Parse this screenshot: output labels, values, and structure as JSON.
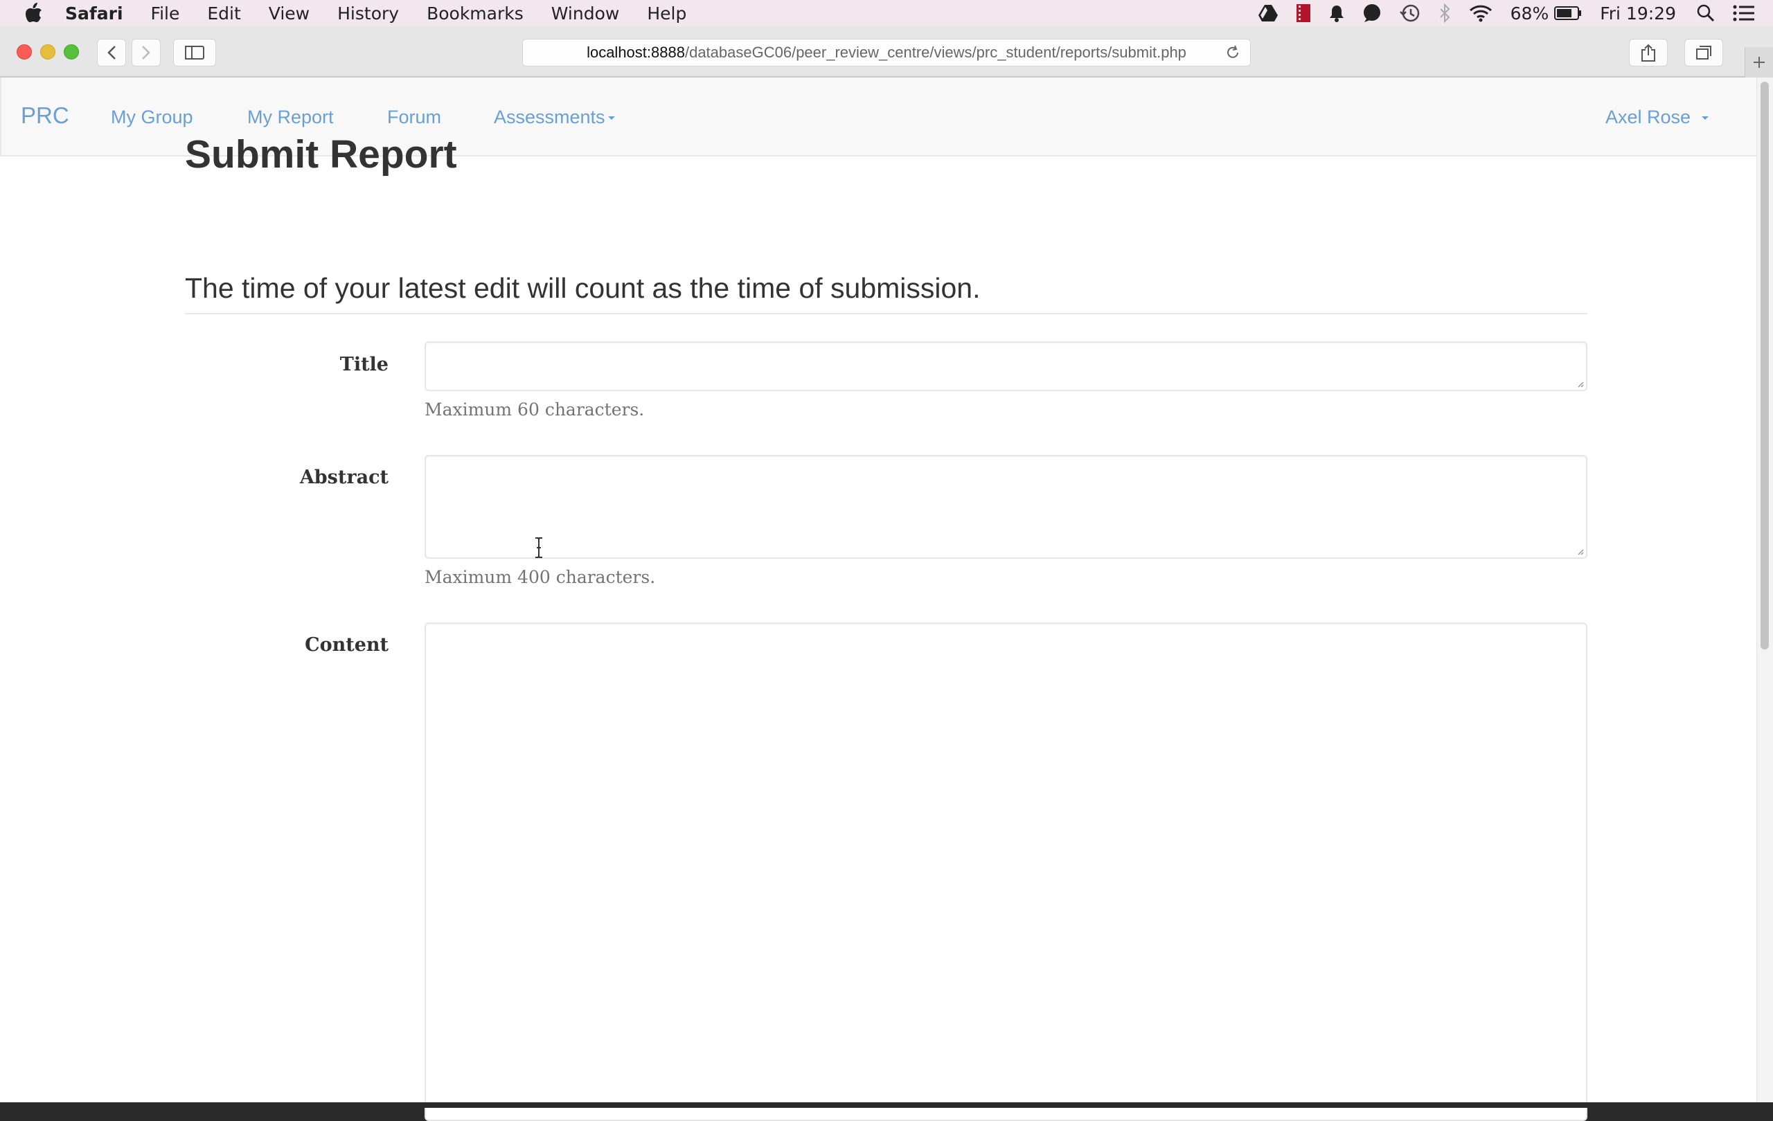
{
  "menubar": {
    "app_name": "Safari",
    "items": [
      "File",
      "Edit",
      "View",
      "History",
      "Bookmarks",
      "Window",
      "Help"
    ],
    "status_icons": [
      "google-drive-icon",
      "stopwatch-icon",
      "notification-bell-icon",
      "speech-bubble-icon",
      "time-machine-icon",
      "bluetooth-icon",
      "wifi-icon"
    ],
    "battery_percent": "68%",
    "clock": "Fri 19:29"
  },
  "browser": {
    "url_host": "localhost:8888",
    "url_path": "/databaseGC06/peer_review_centre/views/prc_student/reports/submit.php"
  },
  "navbar": {
    "brand": "PRC",
    "links": [
      "My Group",
      "My Report",
      "Forum",
      "Assessments"
    ],
    "user": "Axel Rose"
  },
  "form": {
    "title": "Submit Report",
    "subtitle": "The time of your latest edit will count as the time of submission.",
    "title_label": "Title",
    "title_value": "",
    "title_help": "Maximum 60 characters.",
    "abstract_label": "Abstract",
    "abstract_value": "",
    "abstract_help": "Maximum 400 characters.",
    "content_label": "Content",
    "content_value": ""
  },
  "colors": {
    "link": "#6a9fd4",
    "menubar_bg": "#f1e7ec"
  }
}
